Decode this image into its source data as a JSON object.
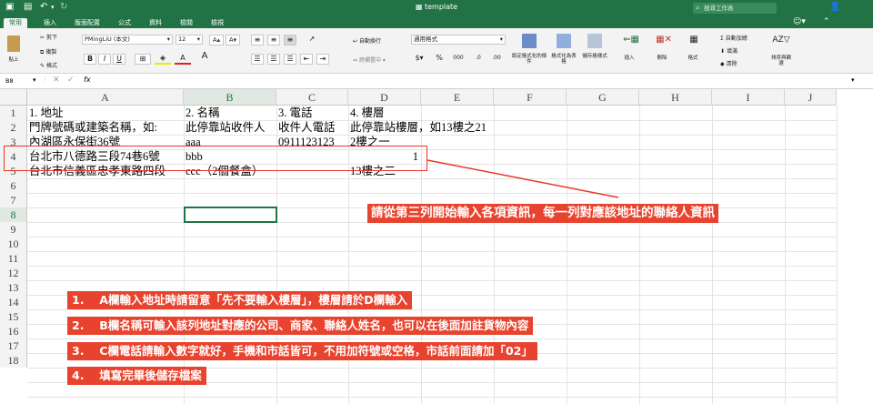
{
  "titlebar": {
    "title": "template",
    "search_placeholder": "搜尋工作表"
  },
  "tabs": [
    "常用",
    "插入",
    "版面配置",
    "公式",
    "資料",
    "檢閱",
    "檢視"
  ],
  "ribbon": {
    "paste": "貼上",
    "cut": "剪下",
    "copy": "複製",
    "format_painter": "格式",
    "font_name": "PMingLiU (本文)",
    "font_size": "12",
    "wrap_text": "自動換行",
    "merge": "跨欄置中",
    "number_format": "通用格式",
    "conditional_format": "設定格式化的條件",
    "format_as_table": "格式化為表格",
    "cell_styles": "儲存格樣式",
    "insert": "插入",
    "delete": "刪除",
    "format": "格式",
    "autosum": "自動加總",
    "fill": "填滿",
    "clear": "清除",
    "sort_filter": "排序與篩選"
  },
  "formula_bar": {
    "name_box": "B8",
    "fx": "fx",
    "formula": ""
  },
  "columns": [
    "A",
    "B",
    "C",
    "D",
    "E",
    "F",
    "G",
    "H",
    "I",
    "J"
  ],
  "rows": [
    "1",
    "2",
    "3",
    "4",
    "5",
    "6",
    "7",
    "8",
    "9",
    "10",
    "11",
    "12",
    "13",
    "14",
    "15",
    "16",
    "17",
    "18"
  ],
  "cells": {
    "A1": "1. 地址",
    "B1": "2. 名稱",
    "C1": "3. 電話",
    "D1": "4. 樓層",
    "A2": "門牌號碼或建築名稱，如:",
    "B2": "此停靠站收件人",
    "C2": "收件人電話",
    "D2": "此停靠站樓層，如13樓之21",
    "A3": "內湖區永保街36號",
    "B3": "aaa",
    "C3": "0911123123",
    "D3": "2樓之一",
    "A4": "台北市八德路三段74巷6號",
    "B4": "bbb",
    "D4": "1",
    "A5": "台北市信義區忠孝東路四段",
    "B5": "ccc（2個餐盒）",
    "D5": "13樓之二"
  },
  "annotations": {
    "callout": "請從第三列開始輸入各項資訊，每一列對應該地址的聯絡人資訊",
    "notes": [
      "1.　 A欄輸入地址時請留意「先不要輸入樓層」，樓層請於D欄輸入",
      "2.　 B欄名稱可輸入該列地址對應的公司、商家、聯絡人姓名，也可以在後面加註貨物內容",
      "3.　 C欄電話請輸入數字就好，手機和市話皆可，不用加符號或空格，市話前面請加「02」",
      "4.　 填寫完畢後儲存檔案"
    ]
  },
  "colors": {
    "excel_green": "#217346",
    "annotation_red": "#e8432e"
  }
}
